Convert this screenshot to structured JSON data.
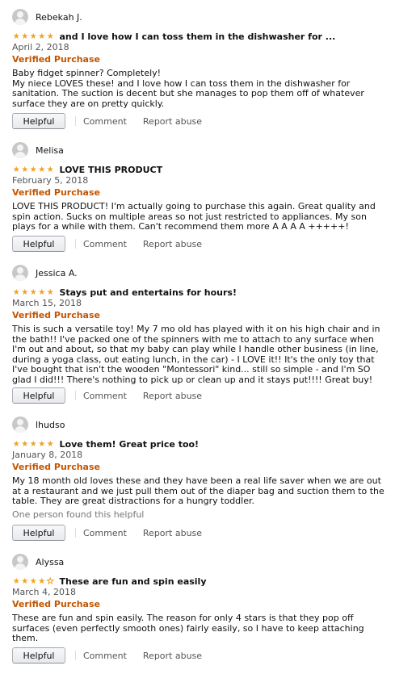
{
  "colors": {
    "star": "#f0a21d",
    "verified": "#c45500",
    "link": "#555555"
  },
  "reviews": [
    {
      "name": "Rebekah J.",
      "rating": 5,
      "title": "and I love how I can toss them in the dishwasher for ...",
      "date": "April 2, 2018",
      "verified": "Verified Purchase",
      "lines": [
        "Baby fidget spinner? Completely!",
        "My niece LOVES these! and I love how I can toss them in the dishwasher for",
        "sanitation. The suction is decent but she manages to pop them off of whatever",
        "surface they are on pretty quickly."
      ],
      "helpful_note": "",
      "helpful_label": "Helpful",
      "comment_label": "Comment",
      "abuse_label": "Report abuse"
    },
    {
      "name": "Melisa",
      "rating": 5,
      "title": "LOVE THIS PRODUCT",
      "date": "February 5, 2018",
      "verified": "Verified Purchase",
      "lines": [
        "LOVE THIS PRODUCT! I'm actually going to purchase this again. Great quality and",
        "spin action. Sucks on multiple areas so not just restricted to appliances. My son",
        "plays for a while with them. Can't recommend them more A A A A +++++!"
      ],
      "helpful_note": "",
      "helpful_label": "Helpful",
      "comment_label": "Comment",
      "abuse_label": "Report abuse"
    },
    {
      "name": "Jessica A.",
      "rating": 5,
      "title": "Stays put and entertains for hours!",
      "date": "March 15, 2018",
      "verified": "Verified Purchase",
      "lines": [
        "This is such a versatile toy! My 7 mo old has played with it on his high chair and in",
        "the bath!! I've packed one of the spinners with me to attach to any surface when",
        "I'm out and about, so that my baby can play while I handle other business (in line,",
        "during a yoga class, out eating lunch, in the car) - I LOVE it!! It's the only toy that",
        "I've bought that isn't the wooden \"Montessori\" kind... still so simple - and I'm SO",
        "glad I did!!! There's nothing to pick up or clean up and it stays put!!!! Great buy!"
      ],
      "helpful_note": "",
      "helpful_label": "Helpful",
      "comment_label": "Comment",
      "abuse_label": "Report abuse"
    },
    {
      "name": "lhudso",
      "rating": 5,
      "title": "Love them! Great price too!",
      "date": "January 8, 2018",
      "verified": "Verified Purchase",
      "lines": [
        "My 18 month old loves these and they have been a real life saver when we are out",
        "at a restaurant and we just pull them out of the diaper bag and suction them to the",
        "table. They are great distractions for a hungry toddler."
      ],
      "helpful_note": "One person found this helpful",
      "helpful_label": "Helpful",
      "comment_label": "Comment",
      "abuse_label": "Report abuse"
    },
    {
      "name": "Alyssa",
      "rating": 4,
      "title": "These are fun and spin easily",
      "date": "March 4, 2018",
      "verified": "Verified Purchase",
      "lines": [
        "These are fun and spin easily. The reason for only 4 stars is that they pop off",
        "surfaces (even perfectly smooth ones) fairly easily, so I have to keep attaching",
        "them."
      ],
      "helpful_note": "",
      "helpful_label": "Helpful",
      "comment_label": "Comment",
      "abuse_label": "Report abuse"
    }
  ]
}
